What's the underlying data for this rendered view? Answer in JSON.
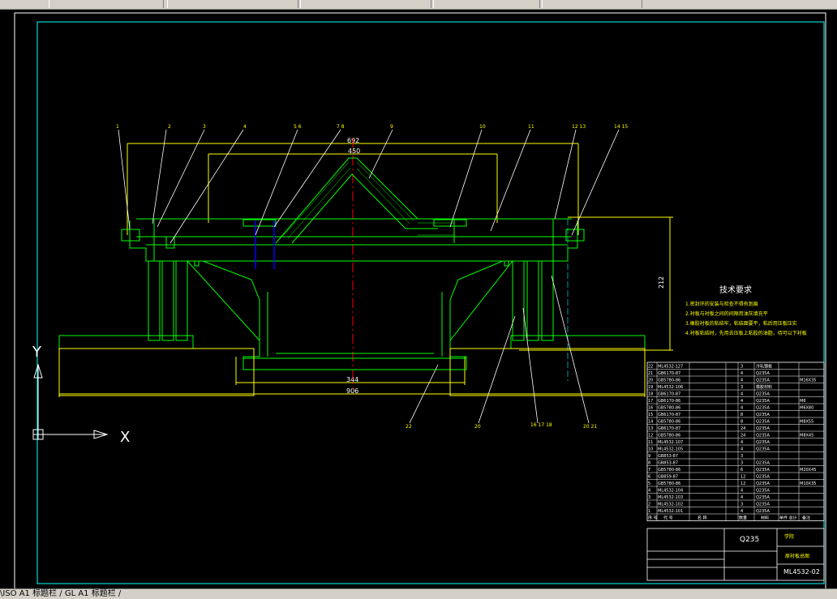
{
  "drawing": {
    "tech_title": "技术要求",
    "tech_notes": [
      "1.密封环的安装与检查不得有划痕",
      "2.衬板与衬板之间的间隙用油灰填充平",
      "3.橡胶衬板的粘结牢，粘结面要平，粘后用压板压实",
      "4.衬板粘结时，先用去压板上粘胶的油脂，待可以下衬板"
    ],
    "dims": {
      "d692": "692",
      "d450": "450",
      "d344": "344",
      "d906": "906",
      "d212": "212"
    },
    "balloons": [
      "1",
      "2",
      "3",
      "4",
      "5 6",
      "7 8",
      "9",
      "10",
      "11",
      "12 13",
      "14 15",
      "22",
      "20",
      "16 17 18",
      "20 21"
    ],
    "axis": {
      "y": "Y",
      "x": "X"
    },
    "material": "Q235",
    "drawing_no": "ML4532-02",
    "part_name": "原衬板总图",
    "company": "学院",
    "header_no": "序 号",
    "header_code": "代 号",
    "header_name": "名 称",
    "header_qty": "数量",
    "header_mat": "材料",
    "header_weight": "单件 总计",
    "header_note": "备注",
    "bom_rows": [
      {
        "no": "22",
        "code": "ML4532-127",
        "qty": "3",
        "mat": "冷轧钢板",
        "note": ""
      },
      {
        "no": "21",
        "code": "GB6170-87",
        "qty": "4",
        "mat": "Q235A",
        "note": ""
      },
      {
        "no": "20",
        "code": "GB5780-86",
        "qty": "4",
        "mat": "Q235A",
        "note": "M16X35"
      },
      {
        "no": "19",
        "code": "ML4532-106",
        "qty": "3",
        "mat": "橡胶材料",
        "note": ""
      },
      {
        "no": "18",
        "code": "GB6170-87",
        "qty": "4",
        "mat": "Q235A",
        "note": ""
      },
      {
        "no": "17",
        "code": "GB6170-86",
        "qty": "4",
        "mat": "Q235A",
        "note": "M6"
      },
      {
        "no": "16",
        "code": "GB5780-86",
        "qty": "4",
        "mat": "Q235A",
        "note": "M6X80"
      },
      {
        "no": "15",
        "code": "GB6170-87",
        "qty": "8",
        "mat": "Q235A",
        "note": ""
      },
      {
        "no": "14",
        "code": "GB5780-86",
        "qty": "8",
        "mat": "Q235A",
        "note": "M8X55"
      },
      {
        "no": "13",
        "code": "GB6170-87",
        "qty": "24",
        "mat": "Q235A",
        "note": ""
      },
      {
        "no": "12",
        "code": "GB5780-86",
        "qty": "24",
        "mat": "Q235A",
        "note": "M8X45"
      },
      {
        "no": "11",
        "code": "ML4532-107",
        "qty": "4",
        "mat": "Q235A",
        "note": ""
      },
      {
        "no": "10",
        "code": "ML4532-105",
        "qty": "4",
        "mat": "Q235A",
        "note": ""
      },
      {
        "no": "9",
        "code": "GB853-87",
        "qty": "3",
        "mat": "",
        "note": ""
      },
      {
        "no": "8",
        "code": "GB853-87",
        "qty": "3",
        "mat": "Q235A",
        "note": ""
      },
      {
        "no": "7",
        "code": "GB5780-86",
        "qty": "6",
        "mat": "Q235A",
        "note": "M20X45"
      },
      {
        "no": "6",
        "code": "GB859-87",
        "qty": "12",
        "mat": "Q235A",
        "note": ""
      },
      {
        "no": "5",
        "code": "GB5780-86",
        "qty": "12",
        "mat": "Q235A",
        "note": "M10X35"
      },
      {
        "no": "4",
        "code": "ML4532-104",
        "qty": "4",
        "mat": "Q235A",
        "note": ""
      },
      {
        "no": "3",
        "code": "ML4532-103",
        "qty": "4",
        "mat": "Q235A",
        "note": ""
      },
      {
        "no": "2",
        "code": "ML4532-102",
        "qty": "3",
        "mat": "Q235A",
        "note": ""
      },
      {
        "no": "1",
        "code": "ML4532-101",
        "qty": "4",
        "mat": "Q235A",
        "note": ""
      }
    ]
  },
  "status": {
    "layout_tabs": "\\ISO A1 标题栏 / GL A1 标题栏 /"
  },
  "colors": {
    "bg": "#000000",
    "part": "#00ff00",
    "frame": "#00ffff",
    "dim": "#ffff00",
    "text": "#ffffff",
    "hidden": "#0000ff",
    "accent": "#ff00ff"
  }
}
